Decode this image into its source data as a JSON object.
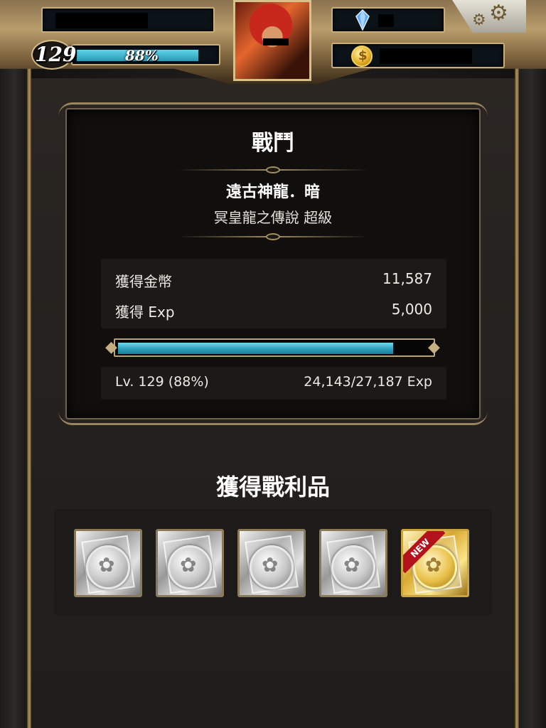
{
  "header": {
    "level": "129",
    "exp_percent": "88%",
    "exp_fraction": 0.88
  },
  "battle": {
    "title": "戰鬥",
    "boss_name": "遠古神龍．暗",
    "boss_subtitle": "冥皇龍之傳說 超級",
    "rewards": [
      {
        "label": "獲得金幣",
        "value": "11,587"
      },
      {
        "label": "獲得 Exp",
        "value": "5,000"
      }
    ],
    "xp_fraction": 0.88,
    "level_text": "Lv. 129 (88%)",
    "exp_text": "24,143/27,187 Exp"
  },
  "loot": {
    "title": "獲得戰利品",
    "items": [
      {
        "kind": "silver-coin-card"
      },
      {
        "kind": "silver-coin-card"
      },
      {
        "kind": "silver-coin-card"
      },
      {
        "kind": "silver-coin-card"
      },
      {
        "kind": "gold-coin-card",
        "badge": "NEW"
      }
    ]
  },
  "colors": {
    "exp_bar": "#2a9bb6",
    "frame_gold": "#c9b07a",
    "new_badge": "#b3121c"
  }
}
